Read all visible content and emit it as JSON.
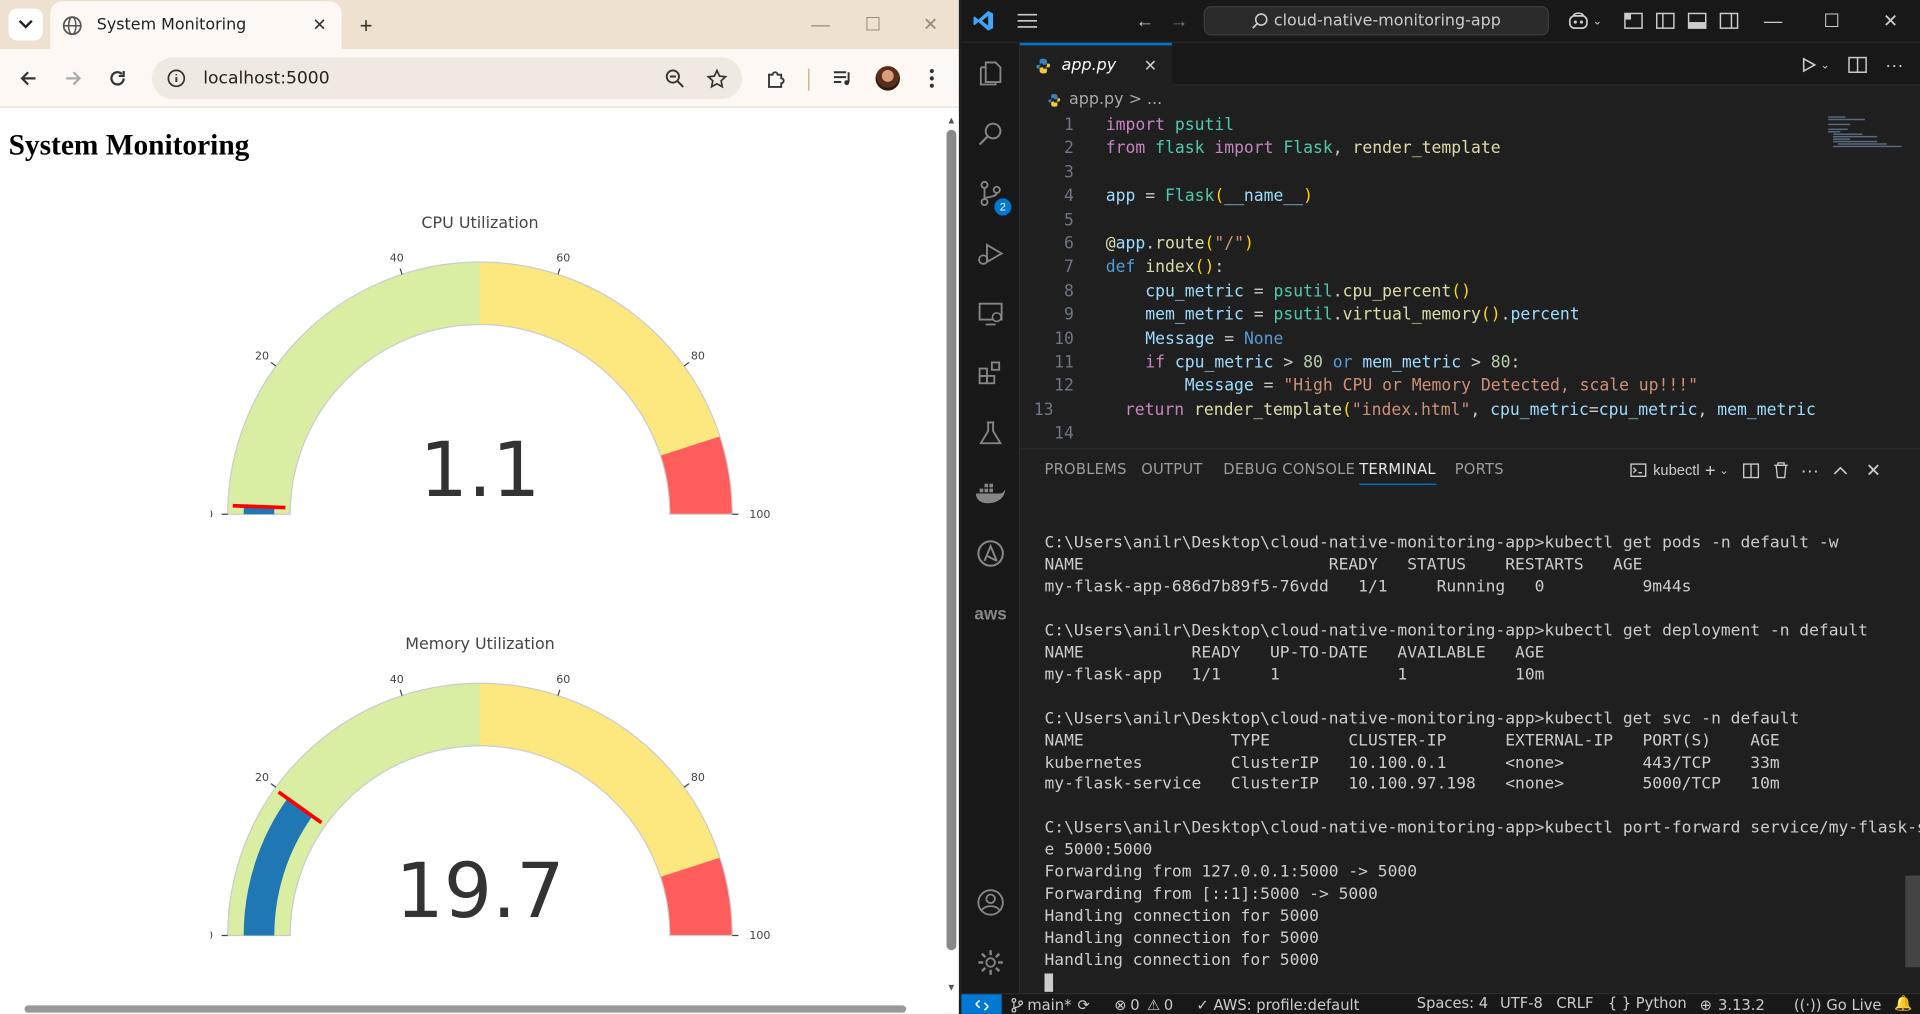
{
  "browser": {
    "tab_title": "System Monitoring",
    "tab_menu_icon": "chevron-down",
    "url": "localhost:5000",
    "page": {
      "heading": "System Monitoring",
      "gauges": [
        {
          "title": "CPU Utilization",
          "value": 1.1,
          "value_text": "1.1",
          "threshold": 1.1,
          "range": [
            0,
            100
          ],
          "tick_labels": [
            "0",
            "20",
            "40",
            "60",
            "80",
            "100"
          ],
          "steps": [
            {
              "range": [
                0,
                50
              ],
              "color": "#d9eda3"
            },
            {
              "range": [
                50,
                90
              ],
              "color": "#fce87f"
            },
            {
              "range": [
                90,
                100
              ],
              "color": "#ff5c5c"
            }
          ],
          "bar_color": "#1f77b4",
          "threshold_color": "#ff0000"
        },
        {
          "title": "Memory Utilization",
          "value": 19.7,
          "value_text": "19.7",
          "threshold": 19.7,
          "range": [
            0,
            100
          ],
          "tick_labels": [
            "0",
            "20",
            "40",
            "60",
            "80",
            "100"
          ],
          "steps": [
            {
              "range": [
                0,
                50
              ],
              "color": "#d9eda3"
            },
            {
              "range": [
                50,
                90
              ],
              "color": "#fce87f"
            },
            {
              "range": [
                90,
                100
              ],
              "color": "#ff5c5c"
            }
          ],
          "bar_color": "#1f77b4",
          "threshold_color": "#ff0000"
        }
      ]
    }
  },
  "vscode": {
    "search_text": "cloud-native-monitoring-app",
    "editor_tab": "app.py",
    "breadcrumb": "app.py > ...",
    "scm_badge": "2",
    "code_lines": [
      {
        "n": "1",
        "html": "<span class='kw'>import</span> <span class='cls'>psutil</span>"
      },
      {
        "n": "2",
        "html": "<span class='kw'>from</span> <span class='cls'>flask</span> <span class='kw'>import</span> <span class='cls'>Flask</span>, <span class='fn'>render_template</span>"
      },
      {
        "n": "3",
        "html": ""
      },
      {
        "n": "4",
        "html": "<span class='vr'>app</span> = <span class='cls'>Flask</span><span class='br'>(</span><span class='vr'>__name__</span><span class='br'>)</span>"
      },
      {
        "n": "5",
        "html": ""
      },
      {
        "n": "6",
        "html": "<span class='fn'>@</span><span class='vr'>app</span>.<span class='fn'>route</span><span class='br'>(</span><span class='st'>\"/\"</span><span class='br'>)</span>"
      },
      {
        "n": "7",
        "html": "<span class='kb'>def</span> <span class='fn'>index</span><span class='br'>()</span>:"
      },
      {
        "n": "8",
        "html": "    <span class='vr'>cpu_metric</span> = <span class='cls'>psutil</span>.<span class='fn'>cpu_percent</span><span class='br'>()</span>"
      },
      {
        "n": "9",
        "html": "    <span class='vr'>mem_metric</span> = <span class='cls'>psutil</span>.<span class='fn'>virtual_memory</span><span class='br'>()</span>.<span class='vr'>percent</span>"
      },
      {
        "n": "10",
        "html": "    <span class='vr'>Message</span> = <span class='kb'>None</span>"
      },
      {
        "n": "11",
        "html": "    <span class='kw'>if</span> <span class='vr'>cpu_metric</span> &gt; <span class='nm'>80</span> <span class='kb'>or</span> <span class='vr'>mem_metric</span> &gt; <span class='nm'>80</span>:"
      },
      {
        "n": "12",
        "html": "        <span class='vr'>Message</span> = <span class='st'>\"High CPU or Memory Detected, scale up!!!\"</span>"
      },
      {
        "n": "13",
        "html": "    <span class='kw'>return</span> <span class='fn'>render_template</span><span class='br'>(</span><span class='st'>\"index.html\"</span>, <span class='vr'>cpu_metric</span>=<span class='vr'>cpu_metric</span>, <span class='vr'>mem_metric</span>"
      },
      {
        "n": "14",
        "html": ""
      }
    ],
    "panel_tabs": [
      "PROBLEMS",
      "OUTPUT",
      "DEBUG CONSOLE",
      "TERMINAL",
      "PORTS"
    ],
    "active_panel_tab": "TERMINAL",
    "terminal_name": "kubectl",
    "terminal_lines": [
      "C:\\Users\\anilr\\Desktop\\cloud-native-monitoring-app>kubectl get pods -n default -w",
      "NAME                         READY   STATUS    RESTARTS   AGE",
      "my-flask-app-686d7b89f5-76vdd   1/1     Running   0          9m44s",
      "",
      "C:\\Users\\anilr\\Desktop\\cloud-native-monitoring-app>kubectl get deployment -n default",
      "NAME           READY   UP-TO-DATE   AVAILABLE   AGE",
      "my-flask-app   1/1     1            1           10m",
      "",
      "C:\\Users\\anilr\\Desktop\\cloud-native-monitoring-app>kubectl get svc -n default",
      "NAME               TYPE        CLUSTER-IP      EXTERNAL-IP   PORT(S)    AGE",
      "kubernetes         ClusterIP   10.100.0.1      <none>        443/TCP    33m",
      "my-flask-service   ClusterIP   10.100.97.198   <none>        5000/TCP   10m",
      "",
      "C:\\Users\\anilr\\Desktop\\cloud-native-monitoring-app>kubectl port-forward service/my-flask-servic",
      "e 5000:5000",
      "Forwarding from 127.0.0.1:5000 -> 5000",
      "Forwarding from [::1]:5000 -> 5000",
      "Handling connection for 5000",
      "Handling connection for 5000",
      "Handling connection for 5000"
    ],
    "status": {
      "branch": "main*",
      "errors": "0",
      "warnings": "0",
      "aws": "AWS: profile:default",
      "spaces": "Spaces: 4",
      "encoding": "UTF-8",
      "eol": "CRLF",
      "language": "{ } Python",
      "python_version": "3.13.2",
      "go_live": "Go Live"
    }
  }
}
